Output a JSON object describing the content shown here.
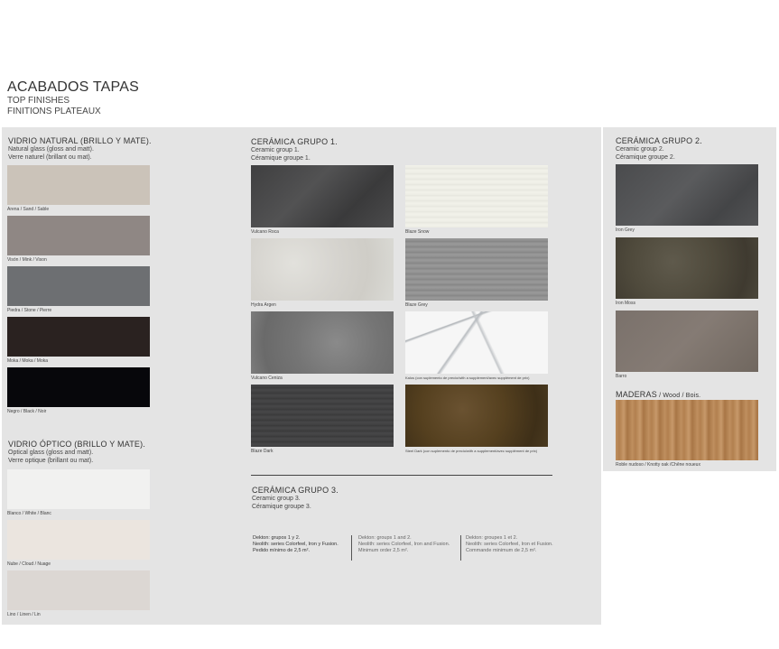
{
  "header": {
    "title": "ACABADOS TAPAS",
    "subtitle_en": "TOP FINISHES",
    "subtitle_fr": "FINITIONS PLATEAUX"
  },
  "vidrio_natural": {
    "title": "VIDRIO NATURAL (BRILLO Y MATE).",
    "line_en": "Natural glass (gloss and matt).",
    "line_fr": "Verre naturel (brillant ou mat).",
    "items": [
      {
        "label": "Arena / Sand / Sable",
        "color": "#cbc3b9"
      },
      {
        "label": "Visón / Mink / Vison",
        "color": "#8f8784"
      },
      {
        "label": "Piedra / Stone / Pierre",
        "color": "#6d6f72"
      },
      {
        "label": "Moka / Moka / Moka",
        "color": "#2a2220"
      },
      {
        "label": "Negro / Black / Noir",
        "color": "#07070b"
      }
    ]
  },
  "vidrio_optico": {
    "title": "VIDRIO ÓPTICO (BRILLO Y MATE).",
    "line_en": "Optical glass (gloss and matt).",
    "line_fr": "Verre optique (brillant ou mat).",
    "items": [
      {
        "label": "Blanco / White / Blanc",
        "color": "#f1f1f0"
      },
      {
        "label": "Nube / Cloud / Nuage",
        "color": "#ebe5df"
      },
      {
        "label": "Lino / Linen / Lin",
        "color": "#dcd7d3"
      }
    ]
  },
  "ceramica1": {
    "title": "CERÁMICA GRUPO 1.",
    "line_en": "Ceramic group 1.",
    "line_fr": "Céramique groupe 1.",
    "items": [
      {
        "label": "Vulcano Roca",
        "texture": "vulcano-roca"
      },
      {
        "label": "Blaze Snow",
        "texture": "blaze-snow"
      },
      {
        "label": "Hydra Argen",
        "texture": "hydra-argen"
      },
      {
        "label": "Blaze Grey",
        "texture": "blaze-grey"
      },
      {
        "label": "Vulcano Ceniza",
        "texture": "vulcano-ceniza"
      },
      {
        "label": "Kalos (con suplemento de precio/with a supplement/avec supplément de prix)",
        "texture": "kalos"
      },
      {
        "label": "Blaze Dark",
        "texture": "blaze-dark"
      },
      {
        "label": "Steel Dark (con suplemento de precio/with a supplement/avec supplément de prix)",
        "texture": "steel-dark"
      }
    ]
  },
  "ceramica2": {
    "title": "CERÁMICA GRUPO 2.",
    "line_en": "Ceramic group 2.",
    "line_fr": "Céramique groupe 2.",
    "items": [
      {
        "label": "Iron Grey",
        "texture": "iron-grey"
      },
      {
        "label": "Iron Moss",
        "texture": "iron-moss"
      },
      {
        "label": "Barro",
        "texture": "barro"
      }
    ]
  },
  "maderas": {
    "title": "MADERAS",
    "title_sub": " / Wood / Bois.",
    "items": [
      {
        "label": "Roble nudoso / Knotty oak /Chêne noueux",
        "texture": "roble"
      }
    ]
  },
  "ceramica3": {
    "title": "CERÁMICA GRUPO 3.",
    "line_en": "Ceramic group 3.",
    "line_fr": "Céramique groupe 3."
  },
  "notes": {
    "es": [
      "Dekton: grupos 1 y 2.",
      "Neolith: series Colorfeel, Iron y Fusion.",
      "Pedido mínimo de 2,5 m²."
    ],
    "en": [
      "Dekton: groups 1 and 2.",
      "Neolith: series Colorfeel, Iron and Fusion.",
      "Minimum order 2,5 m²."
    ],
    "fr": [
      "Dekton: groupes 1 et 2.",
      "Neolith: series Colorfeel, Iron et Fusion.",
      "Commande minimum de 2,5 m²."
    ]
  }
}
